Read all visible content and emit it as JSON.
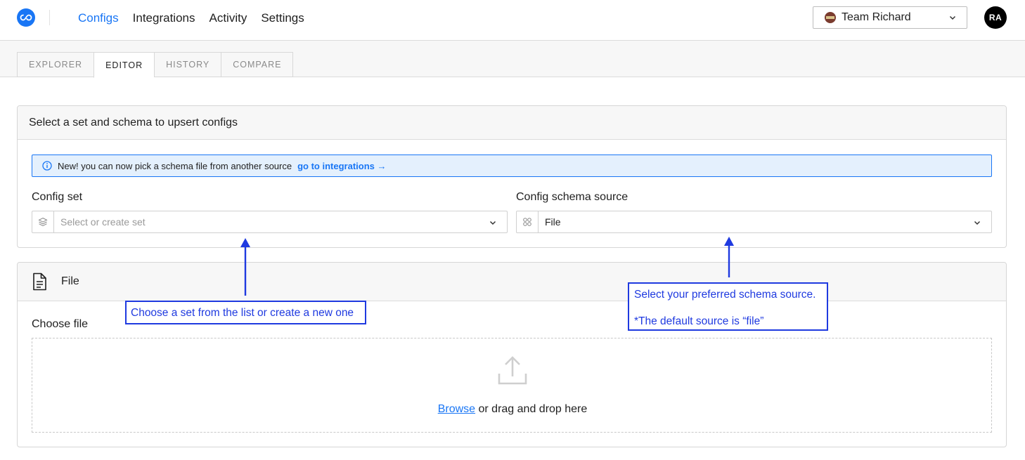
{
  "nav": {
    "items": [
      "Configs",
      "Integrations",
      "Activity",
      "Settings"
    ],
    "active": "Configs"
  },
  "team": {
    "label": "Team Richard"
  },
  "user": {
    "initials": "RA"
  },
  "tabs": [
    "EXPLORER",
    "EDITOR",
    "HISTORY",
    "COMPARE"
  ],
  "active_tab": "EDITOR",
  "select_panel": {
    "title": "Select a set and schema to upsert configs",
    "banner": {
      "text": "New! you can now pick a schema file from another source",
      "link": "go to integrations →"
    },
    "config_set": {
      "label": "Config set",
      "placeholder": "Select or create set"
    },
    "schema_source": {
      "label": "Config schema source",
      "value": "File"
    }
  },
  "file_panel": {
    "title": "File",
    "choose_label": "Choose file",
    "browse": "Browse",
    "drop_text": " or drag and drop here"
  },
  "annotations": {
    "set_hint": "Choose a set from the list or create a new one",
    "schema_hint_1": "Select your preferred schema source.",
    "schema_hint_2": "*The default source is “file”"
  },
  "colors": {
    "accent": "#1976f5",
    "annotation": "#1f3ae0",
    "banner_bg": "#e4f0fd"
  }
}
